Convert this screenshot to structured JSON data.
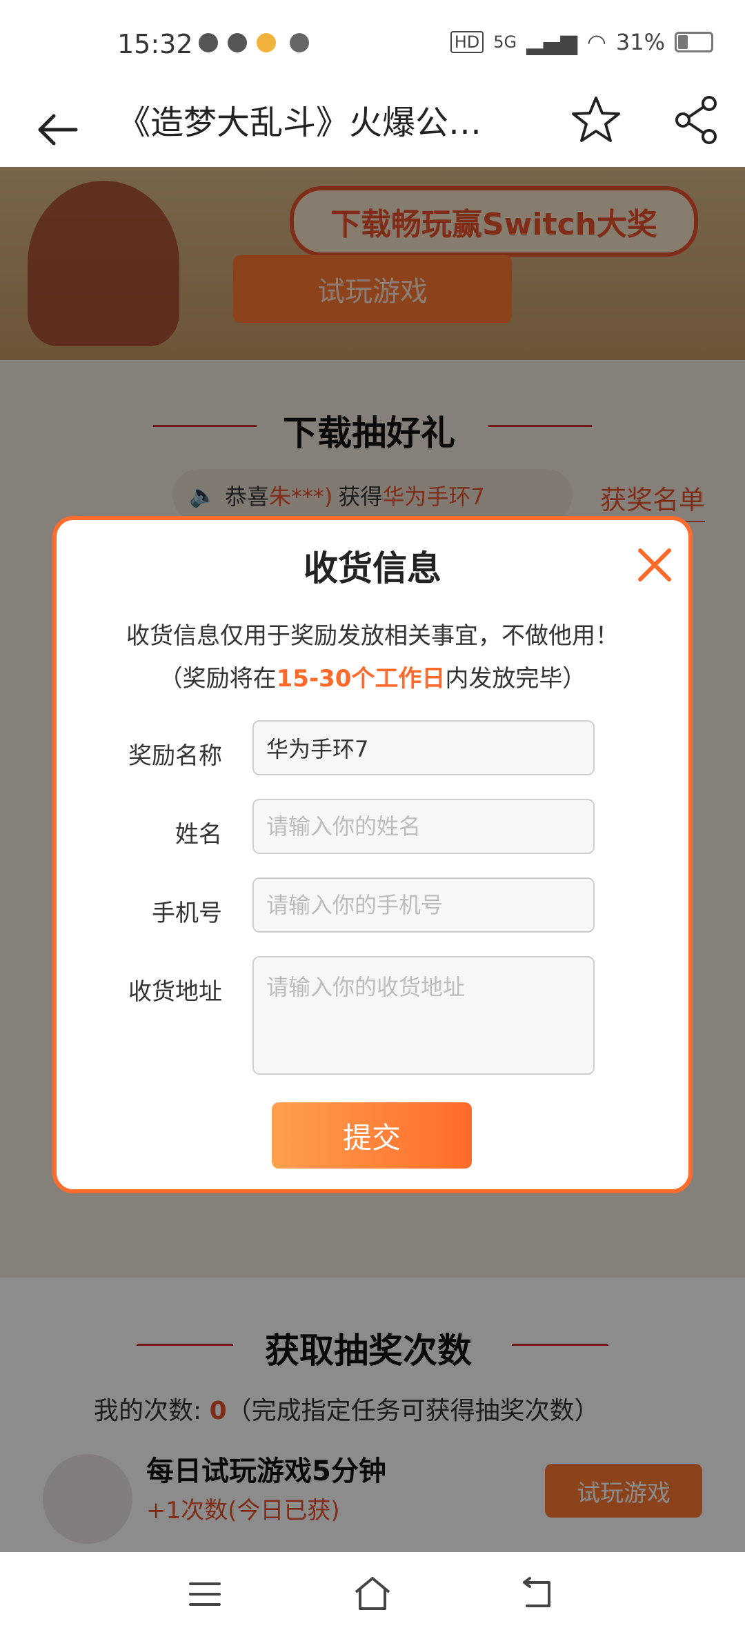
{
  "status": {
    "time": "15:32",
    "network": "5G",
    "battery": "31%"
  },
  "nav": {
    "title": "《造梦大乱斗》火爆公…"
  },
  "banner": {
    "headline": "下载畅玩赢Switch大奖",
    "trial_button": "试玩游戏"
  },
  "lottery_section": {
    "title": "下载抽好礼",
    "winner_prefix": "恭喜",
    "winner_user": "朱***)",
    "winner_mid": "获得",
    "winner_prize": "华为手环7",
    "winner_list_link": "获奖名单"
  },
  "modal": {
    "title": "收货信息",
    "description": "收货信息仅用于奖励发放相关事宜，不做他用！",
    "note_prefix": "（奖励将在",
    "note_highlight": "15-30个工作日",
    "note_suffix": "内发放完毕）",
    "fields": {
      "reward": {
        "label": "奖励名称",
        "value": "华为手环7"
      },
      "name": {
        "label": "姓名",
        "placeholder": "请输入你的姓名"
      },
      "phone": {
        "label": "手机号",
        "placeholder": "请输入你的手机号"
      },
      "address": {
        "label": "收货地址",
        "placeholder": "请输入你的收货地址"
      }
    },
    "submit_label": "提交"
  },
  "chances_section": {
    "title": "获取抽奖次数",
    "count_label": "我的次数: ",
    "count_value": "0",
    "count_hint": "（完成指定任务可获得抽奖次数）",
    "task": {
      "title": "每日试玩游戏5分钟",
      "reward": "+1次数(今日已获)",
      "button": "试玩游戏"
    }
  },
  "colors": {
    "accent": "#ff6a2a",
    "modal_border": "#ff6d2e",
    "highlight_red": "#e7532c"
  }
}
